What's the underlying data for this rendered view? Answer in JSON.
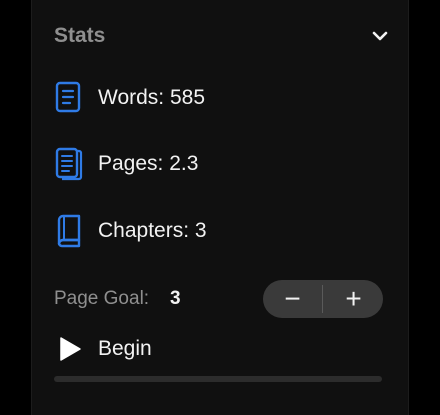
{
  "colors": {
    "accent": "#2f7be6",
    "text": "#f2f2f2",
    "muted": "#8f8f8f",
    "panel": "#101010"
  },
  "section": {
    "title": "Stats",
    "toggle_icon": "chevron-down-icon"
  },
  "stats": [
    {
      "label": "Words: 585",
      "icon": "document-icon"
    },
    {
      "label": "Pages: 2.3",
      "icon": "pages-icon"
    },
    {
      "label": "Chapters: 3",
      "icon": "book-icon"
    }
  ],
  "goal": {
    "label": "Page Goal:",
    "value": "3",
    "decrement_label": "−",
    "increment_label": "+"
  },
  "session": {
    "begin_label": "Begin",
    "icon": "play-icon",
    "progress": 0
  }
}
